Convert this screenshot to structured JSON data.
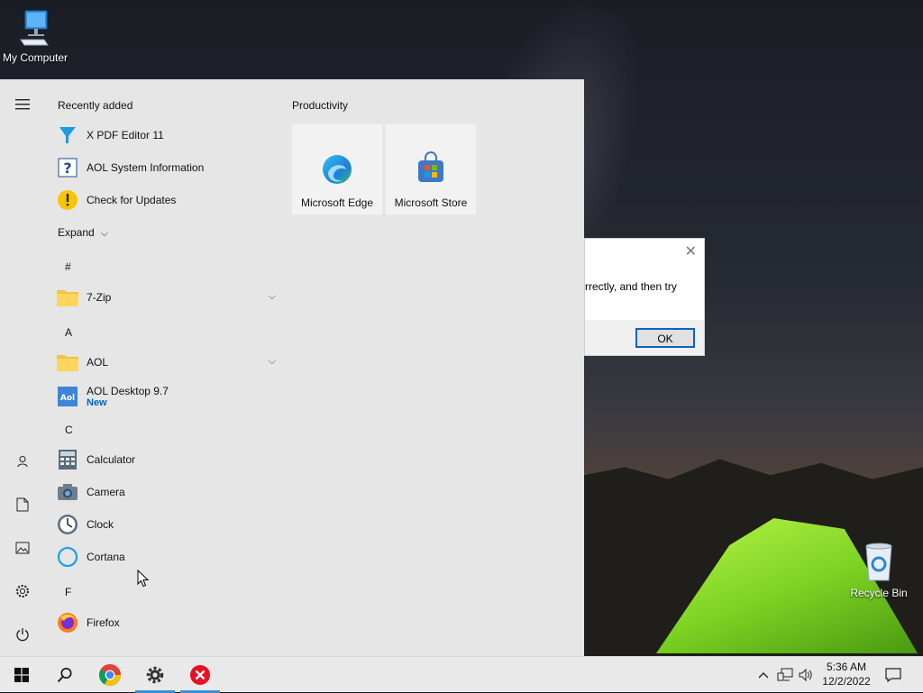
{
  "desktop": {
    "my_computer_label": "My Computer",
    "recycle_bin_label": "Recycle Bin"
  },
  "dialog": {
    "message_fragment": "rrectly, and then try",
    "ok_label": "OK",
    "close_glyph": "✕"
  },
  "start_menu": {
    "recently_added_header": "Recently added",
    "recent_apps": [
      {
        "name": "X PDF Editor 11",
        "icon": "pdf-editor-icon"
      },
      {
        "name": "AOL System Information",
        "icon": "help-icon"
      },
      {
        "name": "Check for Updates",
        "icon": "warning-icon"
      }
    ],
    "expand_label": "Expand",
    "letters": [
      "#",
      "A",
      "C",
      "F"
    ],
    "apps": [
      {
        "name": "7-Zip",
        "icon": "folder-icon",
        "expandable": true
      },
      {
        "name": "AOL",
        "icon": "folder-icon",
        "expandable": true
      },
      {
        "name": "AOL Desktop 9.7",
        "badge": "New",
        "icon": "aol-icon"
      },
      {
        "name": "Calculator",
        "icon": "calculator-icon"
      },
      {
        "name": "Camera",
        "icon": "camera-icon"
      },
      {
        "name": "Clock",
        "icon": "clock-icon"
      },
      {
        "name": "Cortana",
        "icon": "cortana-icon"
      },
      {
        "name": "Firefox",
        "icon": "firefox-icon"
      }
    ],
    "tiles_header": "Productivity",
    "tiles": [
      {
        "name": "Microsoft Edge",
        "icon": "edge-icon"
      },
      {
        "name": "Microsoft Store",
        "icon": "store-icon"
      }
    ],
    "rail_icons": [
      "hamburger-icon",
      "user-icon",
      "document-icon",
      "pictures-icon",
      "settings-icon",
      "power-icon"
    ]
  },
  "taskbar": {
    "items": [
      "start-button",
      "search-button",
      "chrome-button",
      "settings-app-button",
      "error-app-button"
    ],
    "time": "5:36 AM",
    "date": "12/2/2022"
  },
  "colors": {
    "accent": "#0067c0",
    "taskbar_indicator": "#3b8fd9",
    "start_bg": "#e6e6e6"
  }
}
